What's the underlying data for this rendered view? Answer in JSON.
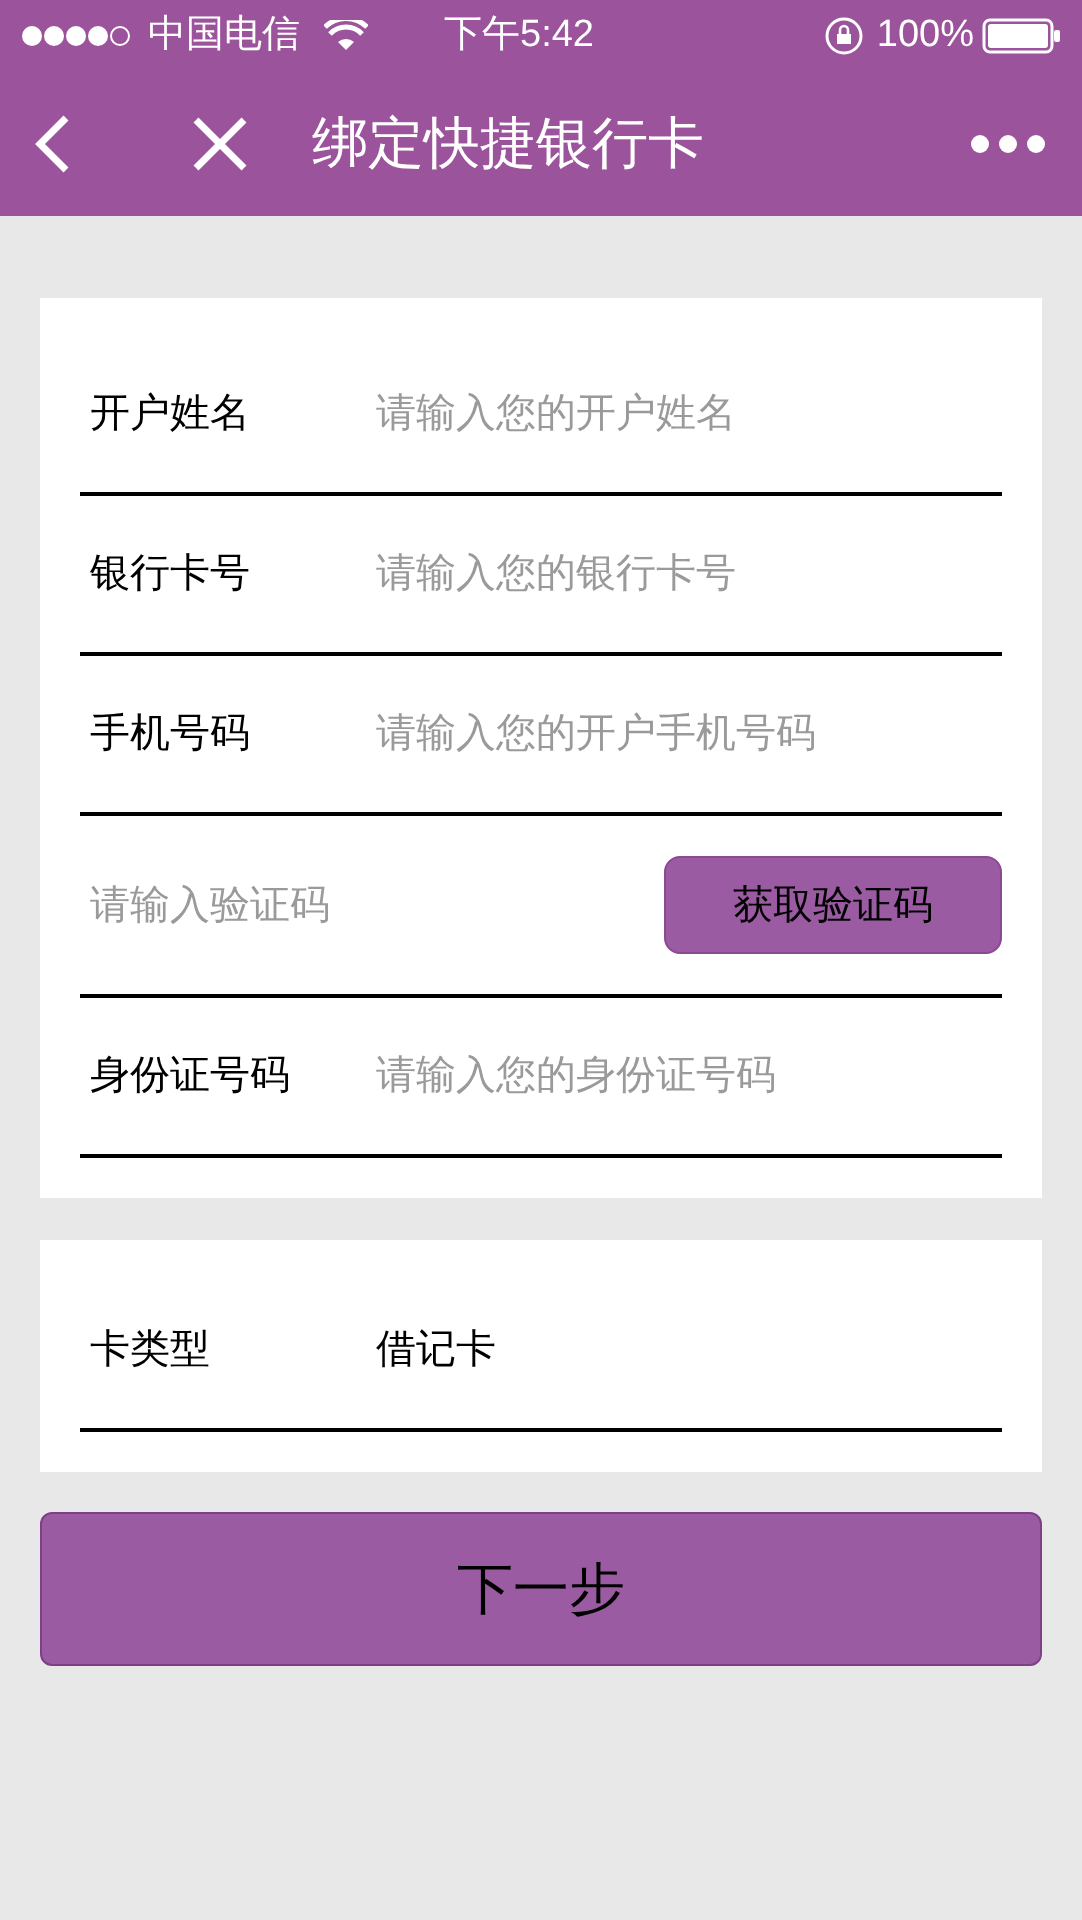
{
  "status_bar": {
    "carrier": "中国电信",
    "time": "下午5:42",
    "battery": "100%"
  },
  "nav": {
    "title": "绑定快捷银行卡"
  },
  "form": [
    {
      "kind": "input",
      "label": "开户姓名",
      "placeholder": "请输入您的开户姓名"
    },
    {
      "kind": "input",
      "label": "银行卡号",
      "placeholder": "请输入您的银行卡号"
    },
    {
      "kind": "input",
      "label": "手机号码",
      "placeholder": "请输入您的开户手机号码"
    },
    {
      "kind": "code",
      "placeholder": "请输入验证码",
      "button": "获取验证码"
    },
    {
      "kind": "input",
      "label": "身份证号码",
      "placeholder": "请输入您的身份证号码"
    }
  ],
  "card_type": {
    "label": "卡类型",
    "value": "借记卡"
  },
  "next_button": "下一步"
}
